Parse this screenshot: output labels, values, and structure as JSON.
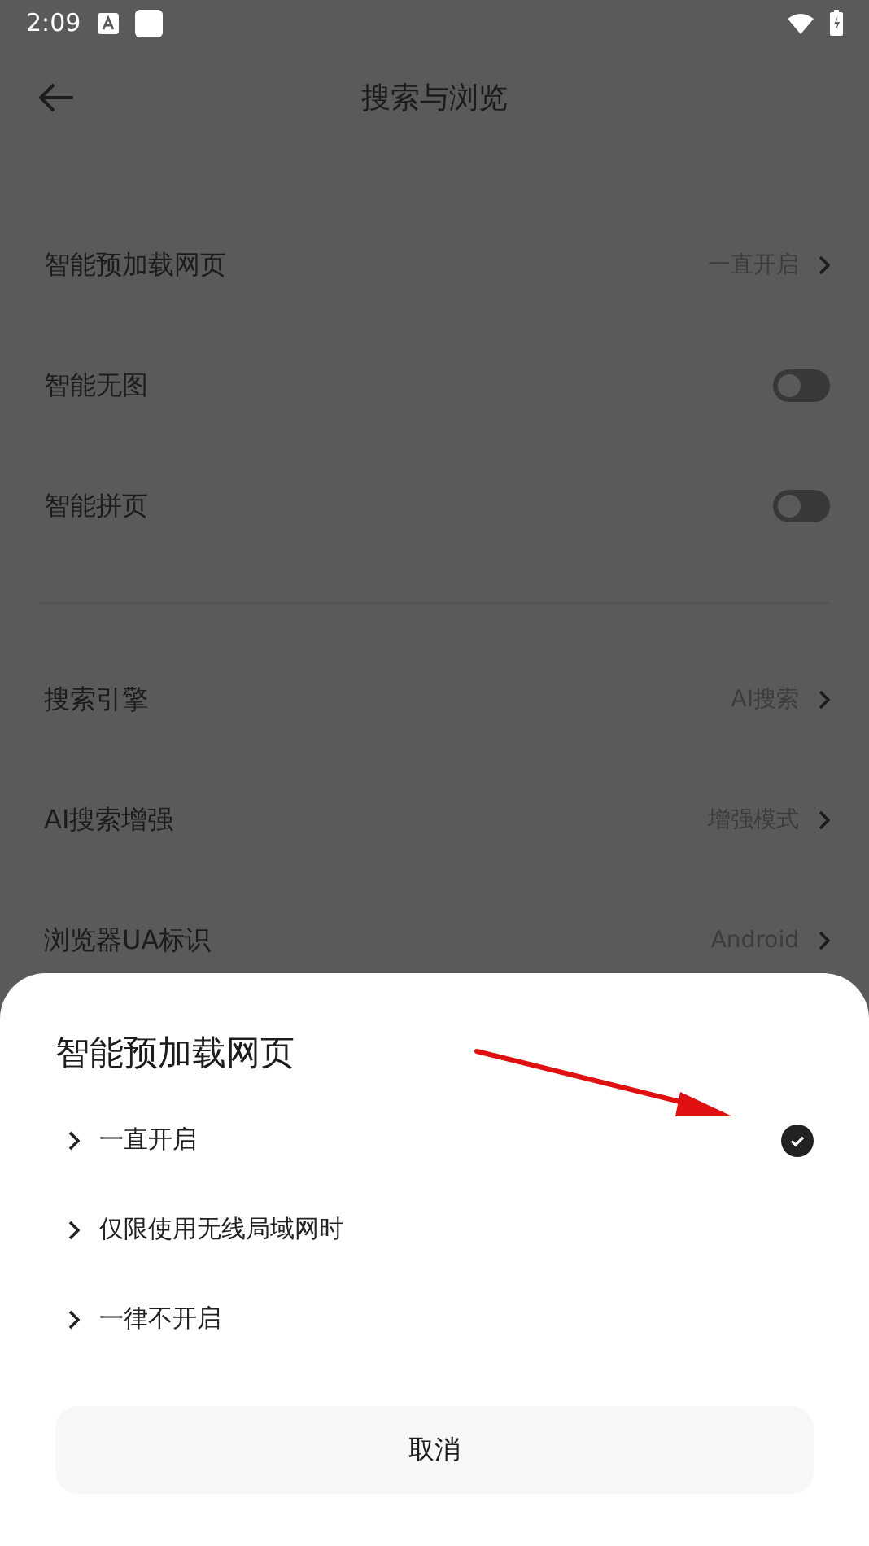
{
  "status_bar": {
    "time": "2:09"
  },
  "header": {
    "title": "搜索与浏览"
  },
  "groups": [
    [
      {
        "kind": "value",
        "label": "智能预加载网页",
        "value": "一直开启"
      },
      {
        "kind": "toggle",
        "label": "智能无图",
        "on": false
      },
      {
        "kind": "toggle",
        "label": "智能拼页",
        "on": false
      }
    ],
    [
      {
        "kind": "value",
        "label": "搜索引擎",
        "value": "AI搜索"
      },
      {
        "kind": "value",
        "label": "AI搜索增强",
        "value": "增强模式"
      },
      {
        "kind": "value",
        "label": "浏览器UA标识",
        "value": "Android"
      }
    ]
  ],
  "sheet": {
    "title": "智能预加载网页",
    "options": [
      {
        "label": "一直开启",
        "selected": true
      },
      {
        "label": "仅限使用无线局域网时",
        "selected": false
      },
      {
        "label": "一律不开启",
        "selected": false
      }
    ],
    "cancel": "取消"
  }
}
